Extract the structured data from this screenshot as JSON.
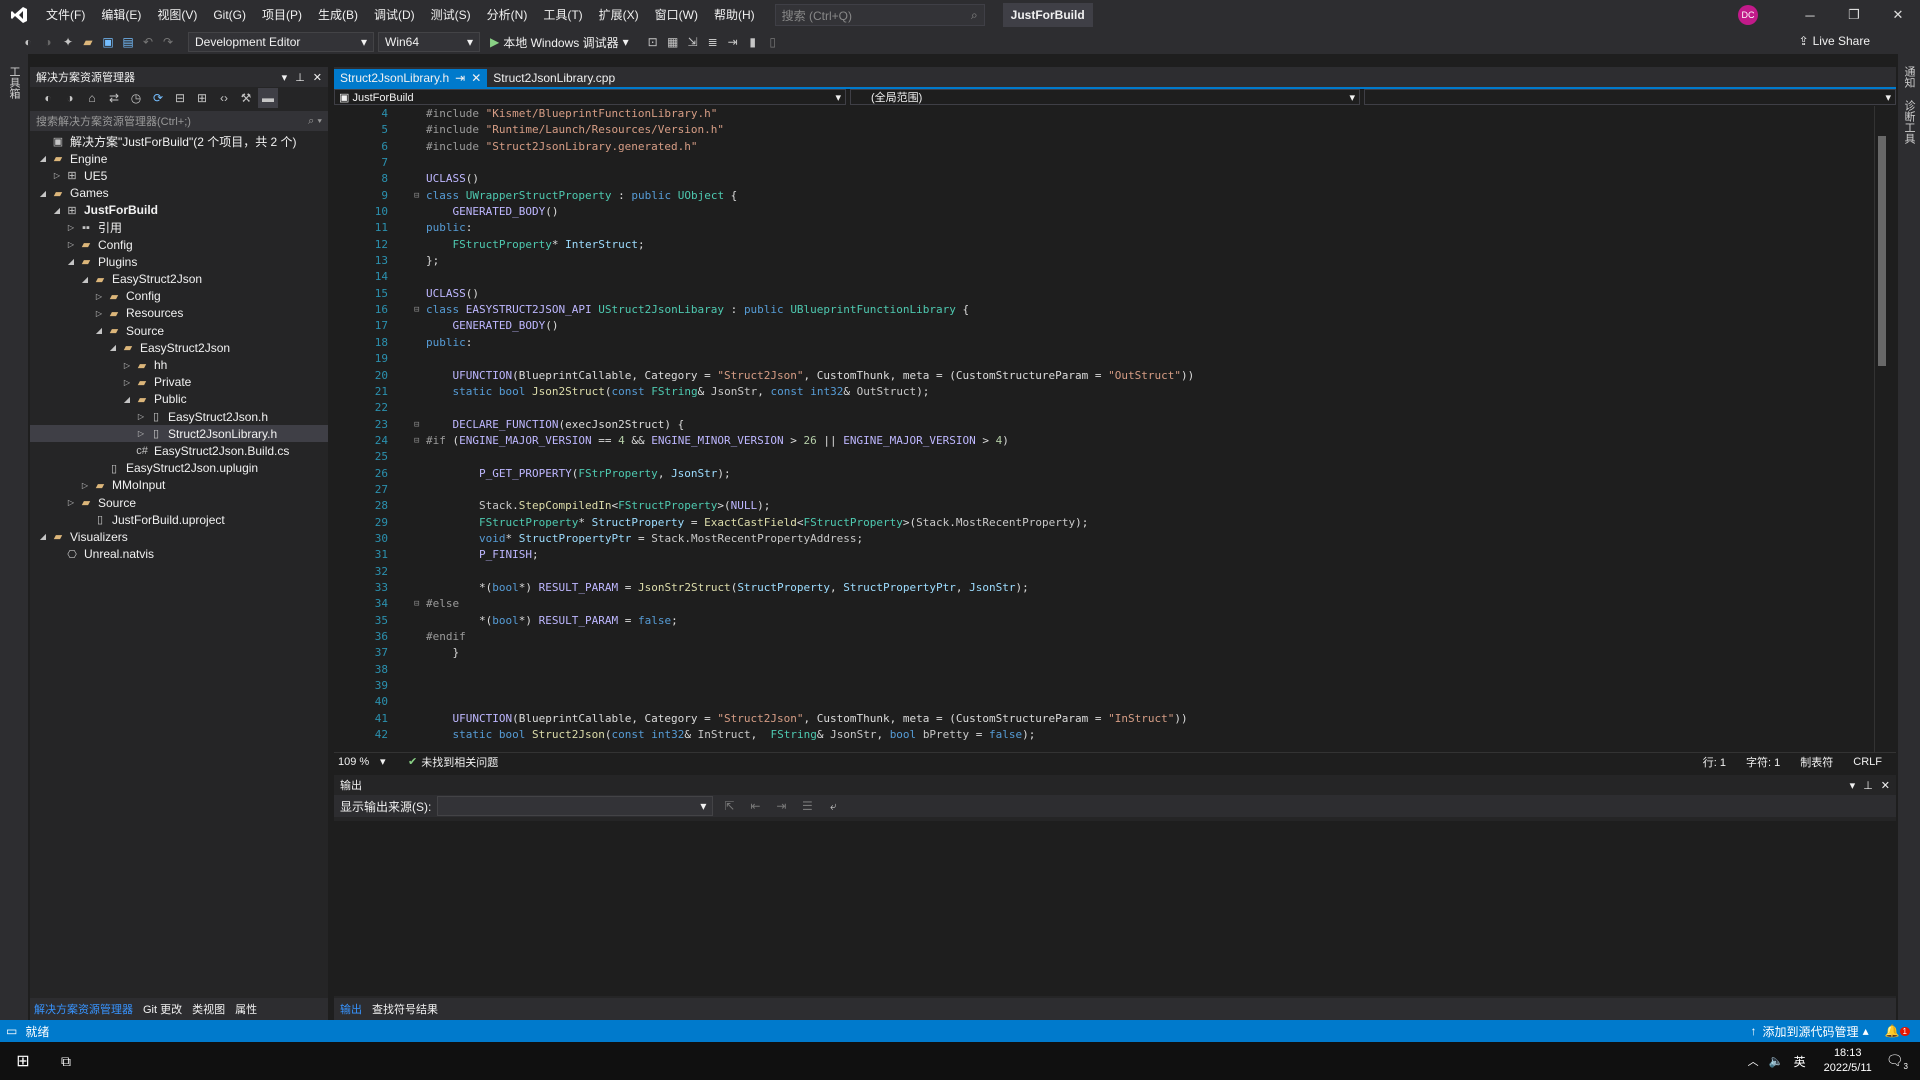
{
  "titlebar": {
    "logo": "VS",
    "menus": [
      "文件(F)",
      "编辑(E)",
      "视图(V)",
      "Git(G)",
      "项目(P)",
      "生成(B)",
      "调试(D)",
      "测试(S)",
      "分析(N)",
      "工具(T)",
      "扩展(X)",
      "窗口(W)",
      "帮助(H)"
    ],
    "search_placeholder": "搜索 (Ctrl+Q)",
    "solution_name": "JustForBuild",
    "avatar": "DC"
  },
  "toolbar": {
    "config": "Development Editor",
    "platform": "Win64",
    "run_label": "本地 Windows 调试器",
    "live_share": "Live Share"
  },
  "left_strip": {
    "label": "工具箱"
  },
  "right_strip": {
    "label1": "通知",
    "label2": "诊断工具"
  },
  "solution_explorer": {
    "title": "解决方案资源管理器",
    "search_placeholder": "搜索解决方案资源管理器(Ctrl+;)",
    "tree": [
      {
        "label": "解决方案\"JustForBuild\"(2 个项目，共 2 个)",
        "depth": 0,
        "twisty": "",
        "icon": "▣",
        "kind": "file",
        "bold": false,
        "selected": false
      },
      {
        "label": "Engine",
        "depth": 0,
        "twisty": "◢",
        "icon": "▰",
        "kind": "folder",
        "bold": false,
        "selected": false
      },
      {
        "label": "UE5",
        "depth": 1,
        "twisty": "▷",
        "icon": "⊞",
        "kind": "file",
        "bold": false,
        "selected": false
      },
      {
        "label": "Games",
        "depth": 0,
        "twisty": "◢",
        "icon": "▰",
        "kind": "folder",
        "bold": false,
        "selected": false
      },
      {
        "label": "JustForBuild",
        "depth": 1,
        "twisty": "◢",
        "icon": "⊞",
        "kind": "file",
        "bold": true,
        "selected": false
      },
      {
        "label": "引用",
        "depth": 2,
        "twisty": "▷",
        "icon": "▪▪",
        "kind": "file",
        "bold": false,
        "selected": false
      },
      {
        "label": "Config",
        "depth": 2,
        "twisty": "▷",
        "icon": "▰",
        "kind": "folder",
        "bold": false,
        "selected": false
      },
      {
        "label": "Plugins",
        "depth": 2,
        "twisty": "◢",
        "icon": "▰",
        "kind": "folder",
        "bold": false,
        "selected": false
      },
      {
        "label": "EasyStruct2Json",
        "depth": 3,
        "twisty": "◢",
        "icon": "▰",
        "kind": "folder",
        "bold": false,
        "selected": false
      },
      {
        "label": "Config",
        "depth": 4,
        "twisty": "▷",
        "icon": "▰",
        "kind": "folder",
        "bold": false,
        "selected": false
      },
      {
        "label": "Resources",
        "depth": 4,
        "twisty": "▷",
        "icon": "▰",
        "kind": "folder",
        "bold": false,
        "selected": false
      },
      {
        "label": "Source",
        "depth": 4,
        "twisty": "◢",
        "icon": "▰",
        "kind": "folder",
        "bold": false,
        "selected": false
      },
      {
        "label": "EasyStruct2Json",
        "depth": 5,
        "twisty": "◢",
        "icon": "▰",
        "kind": "folder",
        "bold": false,
        "selected": false
      },
      {
        "label": "hh",
        "depth": 6,
        "twisty": "▷",
        "icon": "▰",
        "kind": "folder",
        "bold": false,
        "selected": false
      },
      {
        "label": "Private",
        "depth": 6,
        "twisty": "▷",
        "icon": "▰",
        "kind": "folder",
        "bold": false,
        "selected": false
      },
      {
        "label": "Public",
        "depth": 6,
        "twisty": "◢",
        "icon": "▰",
        "kind": "folder",
        "bold": false,
        "selected": false
      },
      {
        "label": "EasyStruct2Json.h",
        "depth": 7,
        "twisty": "▷",
        "icon": "▯",
        "kind": "file",
        "bold": false,
        "selected": false
      },
      {
        "label": "Struct2JsonLibrary.h",
        "depth": 7,
        "twisty": "▷",
        "icon": "▯",
        "kind": "file",
        "bold": false,
        "selected": true
      },
      {
        "label": "EasyStruct2Json.Build.cs",
        "depth": 6,
        "twisty": "",
        "icon": "c#",
        "kind": "file",
        "bold": false,
        "selected": false
      },
      {
        "label": "EasyStruct2Json.uplugin",
        "depth": 4,
        "twisty": "",
        "icon": "▯",
        "kind": "file",
        "bold": false,
        "selected": false
      },
      {
        "label": "MMoInput",
        "depth": 3,
        "twisty": "▷",
        "icon": "▰",
        "kind": "folder",
        "bold": false,
        "selected": false
      },
      {
        "label": "Source",
        "depth": 2,
        "twisty": "▷",
        "icon": "▰",
        "kind": "folder",
        "bold": false,
        "selected": false
      },
      {
        "label": "JustForBuild.uproject",
        "depth": 3,
        "twisty": "",
        "icon": "▯",
        "kind": "file",
        "bold": false,
        "selected": false
      },
      {
        "label": "Visualizers",
        "depth": 0,
        "twisty": "◢",
        "icon": "▰",
        "kind": "folder",
        "bold": false,
        "selected": false
      },
      {
        "label": "Unreal.natvis",
        "depth": 1,
        "twisty": "",
        "icon": "⎔",
        "kind": "file",
        "bold": false,
        "selected": false
      }
    ],
    "tabs": [
      "解决方案资源管理器",
      "Git 更改",
      "类视图",
      "属性"
    ]
  },
  "editor": {
    "tabs": [
      {
        "label": "Struct2JsonLibrary.h",
        "pin": "⇥",
        "close": "✕",
        "active": true
      },
      {
        "label": "Struct2JsonLibrary.cpp",
        "pin": "",
        "close": "",
        "active": false
      }
    ],
    "nav_project": "JustForBuild",
    "nav_scope": "(全局范围)",
    "lines": [
      {
        "n": "4",
        "fold": "",
        "html": "<span class='p'>#include</span> <span class='s'>\"Kismet/BlueprintFunctionLibrary.h\"</span>"
      },
      {
        "n": "5",
        "fold": "",
        "html": "<span class='p'>#include</span> <span class='s'>\"Runtime/Launch/Resources/Version.h\"</span>"
      },
      {
        "n": "6",
        "fold": "",
        "html": "<span class='p'>#include</span> <span class='s'>\"Struct2JsonLibrary.generated.h\"</span>"
      },
      {
        "n": "7",
        "fold": "",
        "html": ""
      },
      {
        "n": "8",
        "fold": "",
        "html": "<span class='m'>UCLASS</span>()"
      },
      {
        "n": "9",
        "fold": "⊟",
        "html": "<span class='k'>class</span> <span class='t'>UWrapperStructProperty</span> : <span class='k'>public</span> <span class='t'>UObject</span> {"
      },
      {
        "n": "10",
        "fold": "",
        "html": "    <span class='m'>GENERATED_BODY</span>()"
      },
      {
        "n": "11",
        "fold": "",
        "html": "<span class='k'>public</span>:"
      },
      {
        "n": "12",
        "fold": "",
        "html": "    <span class='t'>FStructProperty</span>* <span class='v'>InterStruct</span>;"
      },
      {
        "n": "13",
        "fold": "",
        "html": "};"
      },
      {
        "n": "14",
        "fold": "",
        "html": ""
      },
      {
        "n": "15",
        "fold": "",
        "html": "<span class='m'>UCLASS</span>()"
      },
      {
        "n": "16",
        "fold": "⊟",
        "html": "<span class='k'>class</span> <span class='m'>EASYSTRUCT2JSON_API</span> <span class='t'>UStruct2JsonLibaray</span> : <span class='k'>public</span> <span class='t'>UBlueprintFunctionLibrary</span> {"
      },
      {
        "n": "17",
        "fold": "",
        "html": "    <span class='m'>GENERATED_BODY</span>()"
      },
      {
        "n": "18",
        "fold": "",
        "html": "<span class='k'>public</span>:"
      },
      {
        "n": "19",
        "fold": "",
        "html": ""
      },
      {
        "n": "20",
        "fold": "",
        "html": "    <span class='m'>UFUNCTION</span>(BlueprintCallable, Category = <span class='s'>\"Struct2Json\"</span>, CustomThunk, meta = (CustomStructureParam = <span class='s'>\"OutStruct\"</span>))"
      },
      {
        "n": "21",
        "fold": "",
        "html": "    <span class='k'>static</span> <span class='k'>bool</span> <span class='f'>Json2Struct</span>(<span class='k'>const</span> <span class='t'>FString</span>&amp; <span class='g'>JsonStr</span>, <span class='k'>const</span> <span class='k'>int32</span>&amp; <span class='g'>OutStruct</span>);"
      },
      {
        "n": "22",
        "fold": "",
        "html": ""
      },
      {
        "n": "23",
        "fold": "⊟",
        "html": "    <span class='m'>DECLARE_FUNCTION</span>(execJson2Struct) {"
      },
      {
        "n": "24",
        "fold": "⊟",
        "html": "<span class='p'>#if</span> (<span class='m'>ENGINE_MAJOR_VERSION</span> == <span class='n'>4</span> &amp;&amp; <span class='m'>ENGINE_MINOR_VERSION</span> &gt; <span class='n'>26</span> || <span class='m'>ENGINE_MAJOR_VERSION</span> &gt; <span class='n'>4</span>)"
      },
      {
        "n": "25",
        "fold": "",
        "html": ""
      },
      {
        "n": "26",
        "fold": "",
        "html": "        <span class='m'>P_GET_PROPERTY</span>(<span class='t'>FStrProperty</span>, <span class='v'>JsonStr</span>);"
      },
      {
        "n": "27",
        "fold": "",
        "html": ""
      },
      {
        "n": "28",
        "fold": "",
        "html": "        <span class='g'>Stack</span>.<span class='f'>StepCompiledIn</span>&lt;<span class='t'>FStructProperty</span>&gt;(<span class='m'>NULL</span>);"
      },
      {
        "n": "29",
        "fold": "",
        "html": "        <span class='t'>FStructProperty</span>* <span class='v'>StructProperty</span> = <span class='f'>ExactCastField</span>&lt;<span class='t'>FStructProperty</span>&gt;(<span class='g'>Stack</span>.<span class='g'>MostRecentProperty</span>);"
      },
      {
        "n": "30",
        "fold": "",
        "html": "        <span class='k'>void</span>* <span class='v'>StructPropertyPtr</span> = <span class='g'>Stack</span>.<span class='g'>MostRecentPropertyAddress</span>;"
      },
      {
        "n": "31",
        "fold": "",
        "html": "        <span class='m'>P_FINISH</span>;"
      },
      {
        "n": "32",
        "fold": "",
        "html": ""
      },
      {
        "n": "33",
        "fold": "",
        "html": "        *(<span class='k'>bool</span>*) <span class='m'>RESULT_PARAM</span> = <span class='f'>JsonStr2Struct</span>(<span class='v'>StructProperty</span>, <span class='v'>StructPropertyPtr</span>, <span class='v'>JsonStr</span>);"
      },
      {
        "n": "34",
        "fold": "⊟",
        "html": "<span class='p'>#else</span>"
      },
      {
        "n": "35",
        "fold": "",
        "html": "        *(<span class='k'>bool</span>*) <span class='m'>RESULT_PARAM</span> = <span class='k'>false</span>;"
      },
      {
        "n": "36",
        "fold": "",
        "html": "<span class='p'>#endif</span>"
      },
      {
        "n": "37",
        "fold": "",
        "html": "    }"
      },
      {
        "n": "38",
        "fold": "",
        "html": ""
      },
      {
        "n": "39",
        "fold": "",
        "html": ""
      },
      {
        "n": "40",
        "fold": "",
        "html": ""
      },
      {
        "n": "41",
        "fold": "",
        "html": "    <span class='m'>UFUNCTION</span>(BlueprintCallable, Category = <span class='s'>\"Struct2Json\"</span>, CustomThunk, meta = (CustomStructureParam = <span class='s'>\"InStruct\"</span>))"
      },
      {
        "n": "42",
        "fold": "",
        "html": "    <span class='k'>static</span> <span class='k'>bool</span> <span class='f'>Struct2Json</span>(<span class='k'>const</span> <span class='k'>int32</span>&amp; <span class='g'>InStruct</span>,  <span class='t'>FString</span>&amp; <span class='g'>JsonStr</span>, <span class='k'>bool</span> <span class='g'>bPretty</span> = <span class='k'>false</span>);"
      }
    ],
    "zoom": "109 %",
    "issues": "未找到相关问题",
    "line_pos": "行: 1",
    "char_pos": "字符: 1",
    "tabs_mode": "制表符",
    "eol": "CRLF"
  },
  "output": {
    "title": "输出",
    "source_label": "显示输出来源(S):",
    "source_value": "",
    "tabs": [
      "输出",
      "查找符号结果"
    ]
  },
  "statusbar": {
    "ready": "就绪",
    "source_control": "添加到源代码管理",
    "notifications": "1"
  },
  "taskbar": {
    "ime": "英",
    "time": "18:13",
    "date": "2022/5/11",
    "notif_count": "3"
  },
  "colors": {
    "accent": "#007acc",
    "bg": "#1e1e1e",
    "panel": "#252526",
    "chrome": "#2d2d30"
  }
}
